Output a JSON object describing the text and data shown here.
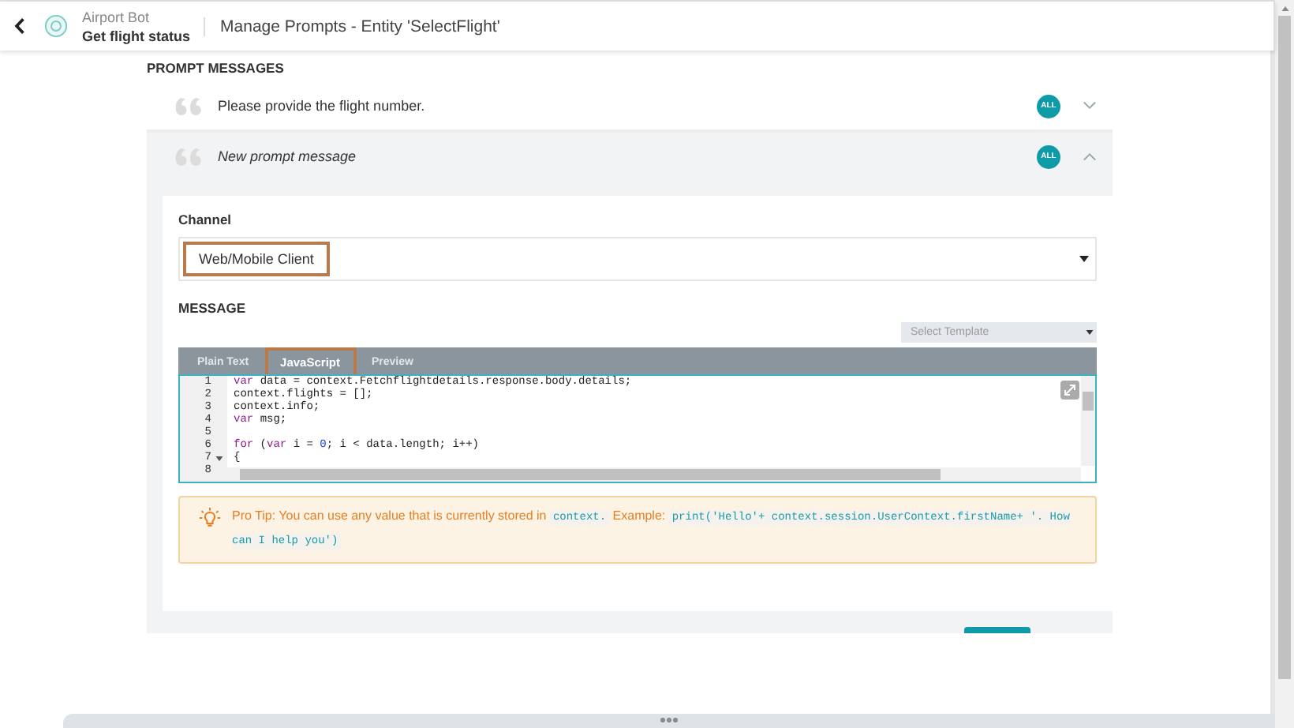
{
  "header": {
    "bot_name": "Airport Bot",
    "task_name": "Get flight status",
    "title": "Manage Prompts - Entity 'SelectFlight'"
  },
  "section_title": "PROMPT MESSAGES",
  "prompts": [
    {
      "text": "Please provide the flight number.",
      "badge": "ALL",
      "expanded": false
    },
    {
      "text": "New prompt message",
      "badge": "ALL",
      "expanded": true
    }
  ],
  "editor": {
    "channel_label": "Channel",
    "channel_value": "Web/Mobile Client",
    "channel_highlighted": true,
    "message_label": "MESSAGE",
    "template_placeholder": "Select Template",
    "tabs": [
      {
        "label": "Plain Text",
        "selected": false,
        "highlighted": false
      },
      {
        "label": "JavaScript",
        "selected": true,
        "highlighted": true
      },
      {
        "label": "Preview",
        "selected": false,
        "highlighted": false
      }
    ],
    "code_lines": [
      {
        "number": "1",
        "code": "var data = context.Fetchflightdetails.response.body.details;",
        "foldable": false
      },
      {
        "number": "2",
        "code": "context.flights = [];",
        "foldable": false
      },
      {
        "number": "3",
        "code": "context.info;",
        "foldable": false
      },
      {
        "number": "4",
        "code": "var msg;",
        "foldable": false
      },
      {
        "number": "5",
        "foldable": false
      },
      {
        "number": "6",
        "code": "for (var i = 0; i < data.length; i++)",
        "foldable": false
      },
      {
        "number": "7",
        "code": "{",
        "foldable": true
      },
      {
        "number": "8",
        "foldable": false
      }
    ],
    "tip": [
      {
        "kind": "text",
        "text": "Pro Tip: You can use any value that is currently stored in "
      },
      {
        "kind": "code",
        "text": "context."
      },
      {
        "kind": "text",
        "text": " Example: "
      },
      {
        "kind": "code",
        "text": "print('Hello'+ context.session.UserContext.firstName+ '. How can I help you')"
      }
    ]
  }
}
